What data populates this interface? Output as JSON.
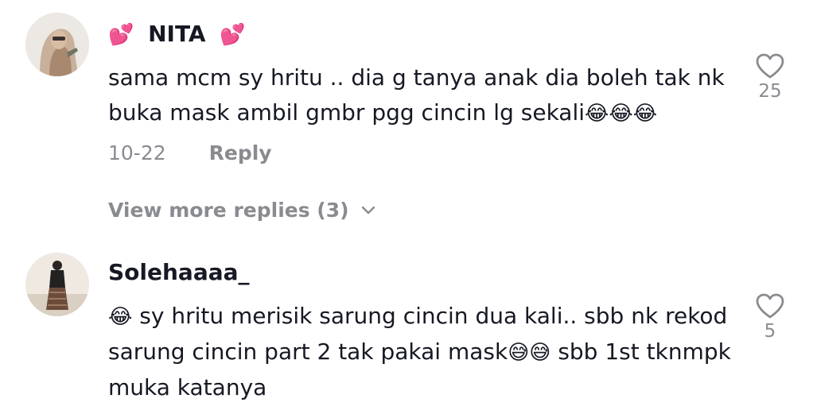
{
  "comments": [
    {
      "username": "NITA",
      "username_deco": "💕",
      "text_line1": "sama mcm sy hritu .. dia g tanya anak dia boleh tak nk",
      "text_line2": "buka mask ambil gmbr pgg cincin lg sekali",
      "text_emoji": "😂😂😂",
      "date": "10-22",
      "reply_label": "Reply",
      "view_more": "View more replies (3)",
      "like_count": "25",
      "like_icon": "heart-outline-icon"
    },
    {
      "username": "Solehaaaa_",
      "text_emoji_lead": "😂",
      "text_line1": "sy hritu merisik sarung cincin dua kali.. sbb nk rekod",
      "text_line2a": "sarung cincin part 2 tak pakai mask",
      "text_emoji_mid": "😅😅",
      "text_line2b": "sbb 1st tknmpk",
      "text_line3": "muka katanya",
      "like_count": "5",
      "like_icon": "heart-outline-icon"
    }
  ],
  "colors": {
    "primary_text": "#161823",
    "secondary_text": "#8a8b91",
    "heart_icon": "#8a8b91",
    "username_deco": "#ff3b8d"
  }
}
